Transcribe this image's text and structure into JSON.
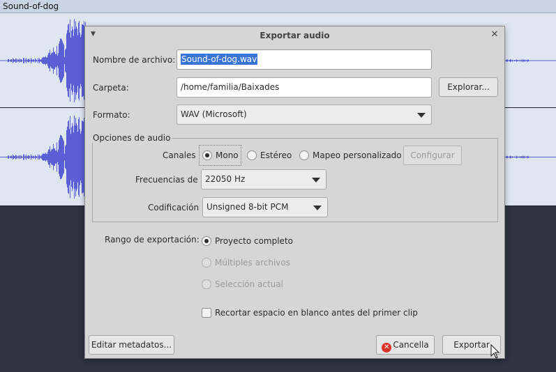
{
  "track": {
    "name": "Sound-of-dog"
  },
  "dialog": {
    "title": "Exportar audio",
    "filename_label": "Nombre de archivo:",
    "filename_value": "Sound-of-dog.wav",
    "folder_label": "Carpeta:",
    "folder_value": "/home/familia/Baixades",
    "browse_label": "Explorar...",
    "format_label": "Formato:",
    "format_value": "WAV (Microsoft)",
    "audio_options": {
      "legend": "Opciones de audio",
      "channels_label": "Canales",
      "channel_options": [
        "Mono",
        "Estéreo",
        "Mapeo personalizado"
      ],
      "channel_selected": "Mono",
      "configure_label": "Configurar",
      "frequency_label": "Frecuencias de",
      "frequency_value": "22050 Hz",
      "encoding_label": "Codificación",
      "encoding_value": "Unsigned 8-bit PCM"
    },
    "export_range": {
      "label": "Rango de exportación:",
      "options": [
        "Proyecto completo",
        "Múltiples archivos",
        "Selección actual"
      ],
      "selected": "Proyecto completo"
    },
    "trim_label": "Recortar espacio en blanco antes del primer clip",
    "trim_checked": false,
    "edit_metadata_label": "Editar metadatos...",
    "cancel_label": "Cancella",
    "export_label": "Exportar"
  },
  "colors": {
    "waveform": "#5a5fd6",
    "track_bg": "#dfe6f2",
    "below_track_bg": "#2f3342",
    "dialog_bg": "#d6d6d6",
    "selection": "#3875d7",
    "cancel_icon": "#d9352b"
  },
  "icons": {
    "window_menu": "chevron-down-icon",
    "close": "close-icon",
    "cancel": "cancel-circle-icon",
    "dropdown": "dropdown-arrow-icon",
    "pointer": "mouse-pointer-icon"
  }
}
